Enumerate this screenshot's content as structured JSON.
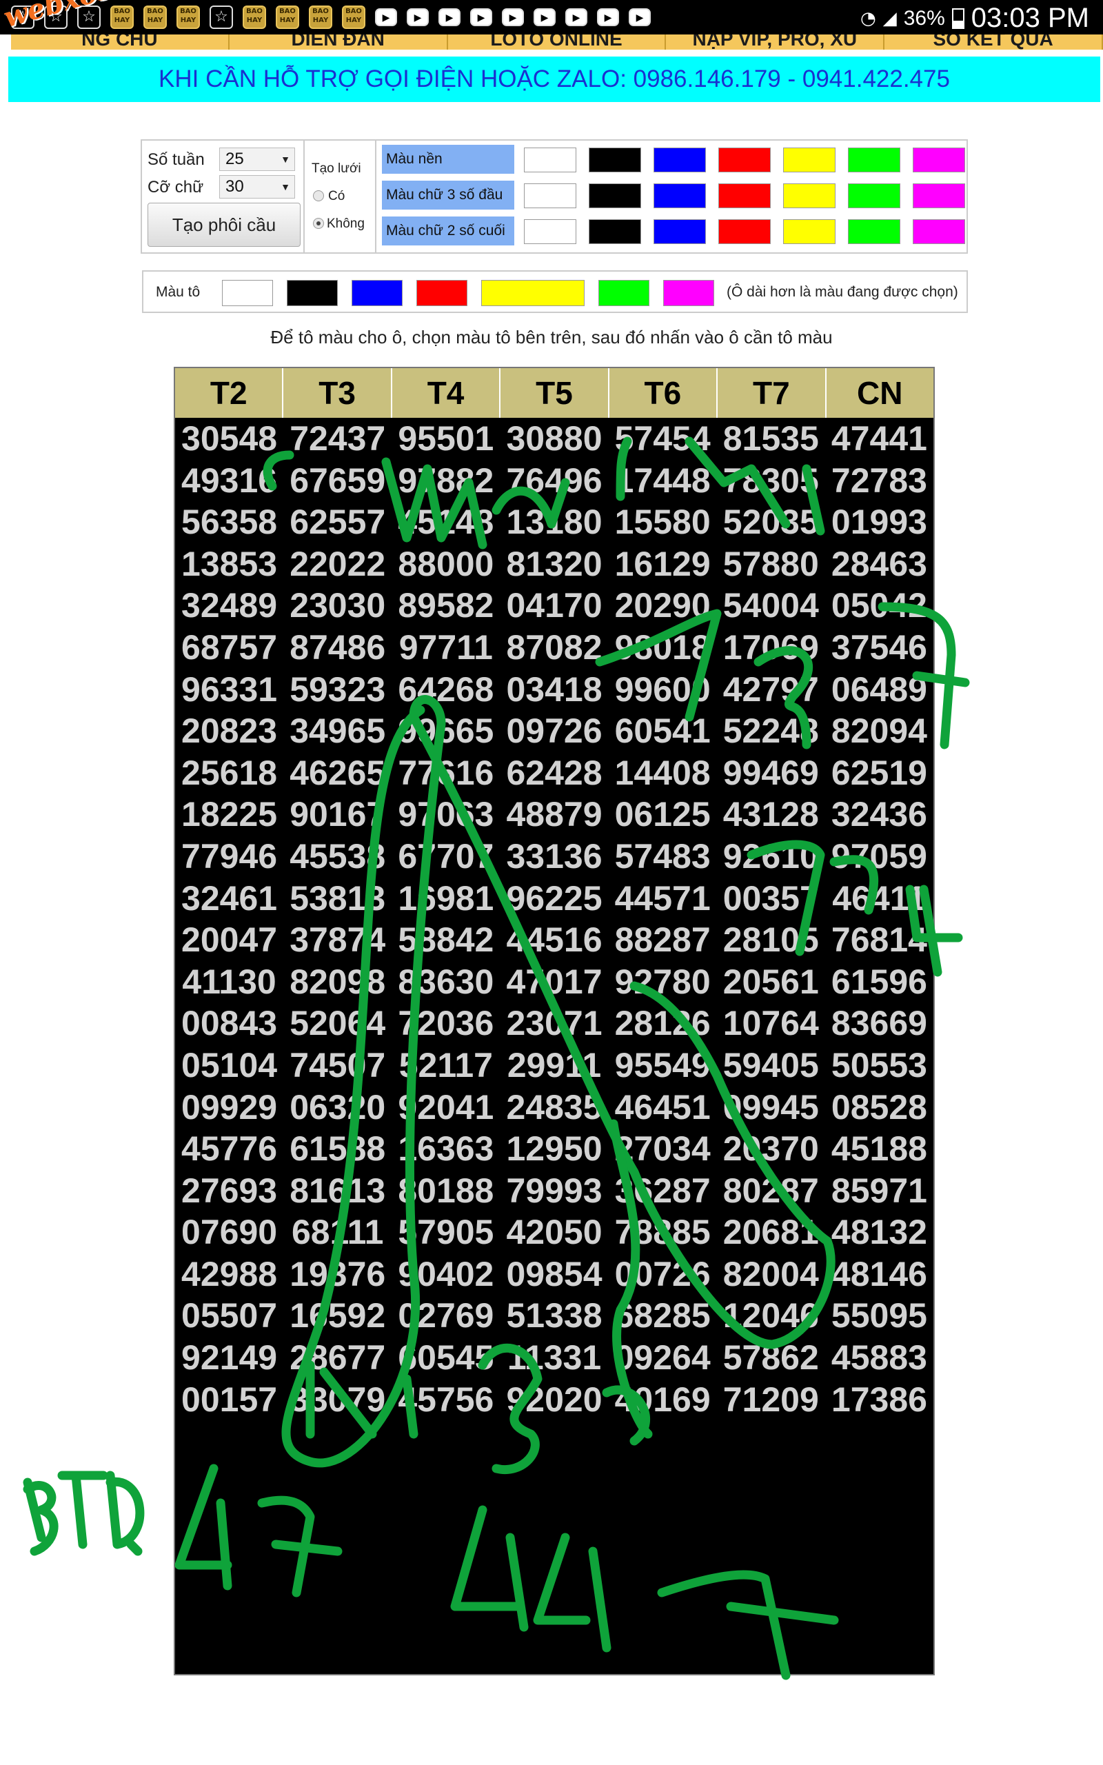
{
  "status_bar": {
    "battery": "36%",
    "clock": "03:03 PM"
  },
  "nav": {
    "logo": "webxoso.net",
    "items": [
      "NG CHỦ",
      "DIỄN ĐÀN",
      "LÔTÔ ONLINE",
      "NẠP VIP, PRO, XU",
      "SỔ KẾT QUẢ"
    ]
  },
  "hotline": "KHI CẦN HỖ TRỢ GỌI ĐIỆN HOẶC ZALO: 0986.146.179 - 0941.422.475",
  "settings": {
    "weeks_label": "Số tuần",
    "weeks_value": "25",
    "font_label": "Cỡ chữ",
    "font_value": "30",
    "create_button": "Tạo phôi cầu",
    "grid_label": "Tạo lưới",
    "grid_yes": "Có",
    "grid_no": "Không",
    "rows": [
      {
        "label": "Màu nền"
      },
      {
        "label": "Màu chữ 3 số đầu"
      },
      {
        "label": "Màu chữ 2 số cuối"
      }
    ],
    "palette": [
      "#ffffff",
      "#000000",
      "#0000ff",
      "#ff0000",
      "#ffff00",
      "#00ff00",
      "#ff00ff"
    ]
  },
  "paint": {
    "label": "Màu tô",
    "hint": "(Ô dài hơn là màu đang được chọn)",
    "selected_color": "#ffff00"
  },
  "instruction": "Để tô màu cho ô, chọn màu tô bên trên, sau đó nhấn vào ô cần tô màu",
  "table": {
    "headers": [
      "T2",
      "T3",
      "T4",
      "T5",
      "T6",
      "T7",
      "CN"
    ],
    "rows": [
      [
        "30548",
        "72437",
        "95501",
        "30880",
        "57454",
        "81535",
        "47441"
      ],
      [
        "49316",
        "67659",
        "97882",
        "76496",
        "17448",
        "78305",
        "72783"
      ],
      [
        "56358",
        "62557",
        "45148",
        "13180",
        "15580",
        "52035",
        "01993"
      ],
      [
        "13853",
        "22022",
        "88000",
        "81320",
        "16129",
        "57880",
        "28463"
      ],
      [
        "32489",
        "23030",
        "89582",
        "04170",
        "20290",
        "54004",
        "05042"
      ],
      [
        "68757",
        "87486",
        "97711",
        "87082",
        "98018",
        "17069",
        "37546"
      ],
      [
        "96331",
        "59323",
        "64268",
        "03418",
        "99600",
        "42797",
        "06489"
      ],
      [
        "20823",
        "34965",
        "99665",
        "09726",
        "60541",
        "52248",
        "82094"
      ],
      [
        "25618",
        "46265",
        "77616",
        "62428",
        "14408",
        "99469",
        "62519"
      ],
      [
        "18225",
        "90167",
        "97063",
        "48879",
        "06125",
        "43128",
        "32436"
      ],
      [
        "77946",
        "45538",
        "67707",
        "33136",
        "57483",
        "92610",
        "97059"
      ],
      [
        "32461",
        "53813",
        "16981",
        "96225",
        "44571",
        "00357",
        "46411"
      ],
      [
        "20047",
        "37874",
        "58842",
        "44516",
        "88287",
        "28105",
        "76814"
      ],
      [
        "41130",
        "82098",
        "83630",
        "47017",
        "92780",
        "20561",
        "61596"
      ],
      [
        "00843",
        "52064",
        "72036",
        "23071",
        "28126",
        "10764",
        "83669"
      ],
      [
        "05104",
        "74507",
        "52117",
        "29911",
        "95549",
        "59405",
        "50553"
      ],
      [
        "09929",
        "06320",
        "92041",
        "24835",
        "46451",
        "09945",
        "08528"
      ],
      [
        "45776",
        "61588",
        "16363",
        "12950",
        "27034",
        "20370",
        "45188"
      ],
      [
        "27693",
        "81613",
        "80188",
        "79993",
        "36287",
        "80287",
        "85971"
      ],
      [
        "07690",
        "68111",
        "57905",
        "42050",
        "78885",
        "20681",
        "48132"
      ],
      [
        "42988",
        "19376",
        "90402",
        "09854",
        "00726",
        "82004",
        "48146"
      ],
      [
        "05507",
        "16592",
        "02769",
        "51338",
        "68285",
        "12046",
        "55095"
      ],
      [
        "92149",
        "28677",
        "60545",
        "11331",
        "09264",
        "57862",
        "45883"
      ],
      [
        "00157",
        "33079",
        "45756",
        "92020",
        "40169",
        "71209",
        "17386"
      ]
    ]
  }
}
